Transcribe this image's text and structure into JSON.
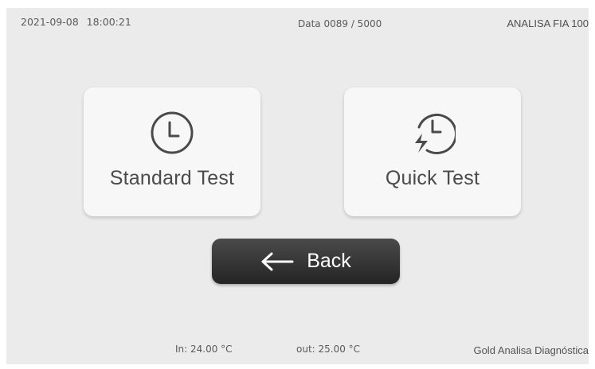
{
  "header": {
    "date": "2021-09-08",
    "time": "18:00:21",
    "record_counter": "Data 0089 / 5000",
    "device_name": "ANALISA FIA 100"
  },
  "tiles": [
    {
      "label": "Standard Test",
      "icon": "clock-icon"
    },
    {
      "label": "Quick Test",
      "icon": "quick-clock-icon"
    }
  ],
  "back_button": {
    "label": "Back",
    "icon": "arrow-left-icon"
  },
  "footer": {
    "temp_in": "In: 24.00 °C",
    "temp_out": "out: 25.00 °C",
    "brand": "Gold Analisa Diagnóstica"
  },
  "colors": {
    "background": "#ebebeb",
    "tile": "#f7f7f7",
    "text": "#555555",
    "back_button": "#333333"
  }
}
